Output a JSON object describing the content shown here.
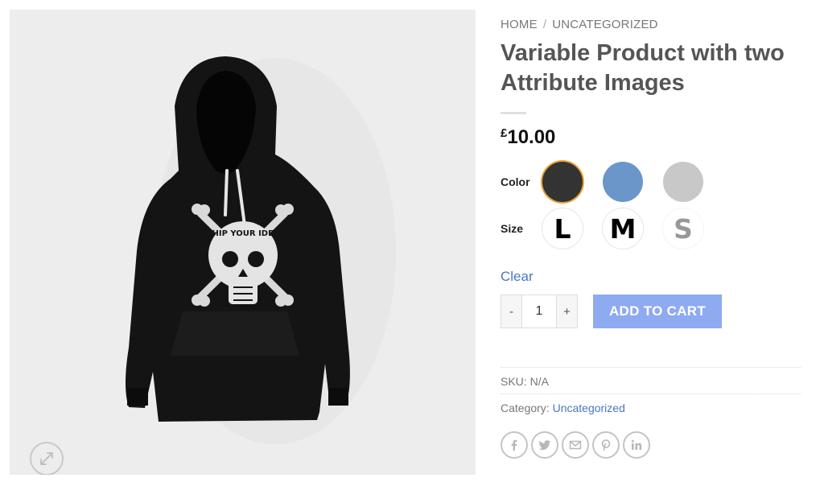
{
  "breadcrumb": {
    "home": "HOME",
    "separator": "/",
    "category": "UNCATEGORIZED"
  },
  "product": {
    "title": "Variable Product with two Attribute Images",
    "currency_symbol": "£",
    "price": "10.00",
    "image_print_text": "SHIP YOUR IDEA"
  },
  "attributes": {
    "color_label": "Color",
    "color_swatches": [
      {
        "name": "black",
        "color": "#333333",
        "selected": true
      },
      {
        "name": "blue",
        "color": "#6b96c9",
        "selected": false
      },
      {
        "name": "grey",
        "color": "#c8c8c8",
        "selected": false
      }
    ],
    "size_label": "Size",
    "size_swatches": [
      {
        "label": "L",
        "available": true
      },
      {
        "label": "M",
        "available": true
      },
      {
        "label": "S",
        "available": false
      }
    ],
    "clear_label": "Clear"
  },
  "cart": {
    "minus": "-",
    "quantity": "1",
    "plus": "+",
    "add_to_cart": "ADD TO CART"
  },
  "meta": {
    "sku_label": "SKU:",
    "sku_value": "N/A",
    "category_label": "Category:",
    "category_value": "Uncategorized"
  },
  "share_icons": [
    "facebook-icon",
    "twitter-icon",
    "email-icon",
    "pinterest-icon",
    "linkedin-icon"
  ],
  "colors": {
    "accent_link": "#4a77c4",
    "button_bg": "#8eaaf0",
    "selected_ring": "#e8a33a",
    "gallery_bg": "#ededed"
  }
}
